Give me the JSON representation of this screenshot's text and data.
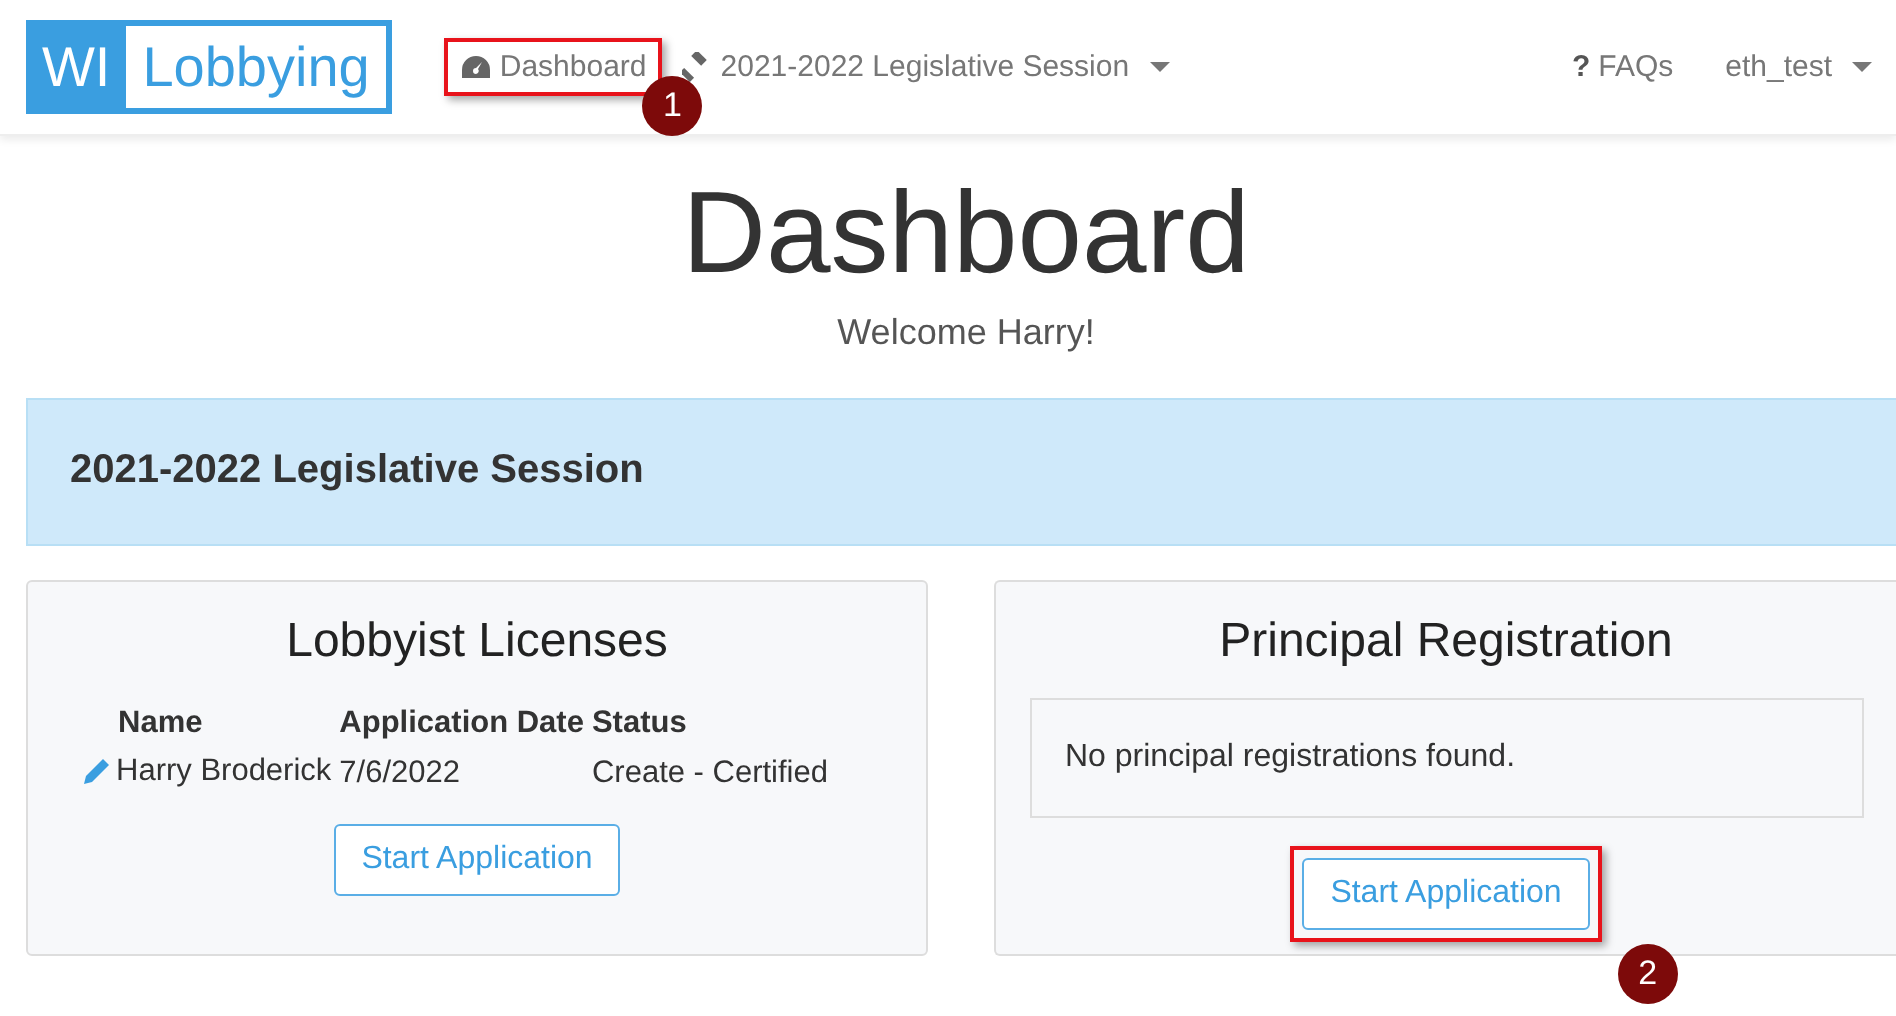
{
  "logo": {
    "prefix": "WI",
    "name": "Lobbying"
  },
  "nav": {
    "items": [
      {
        "kind": "link",
        "label": "Dashboard",
        "callout": "1"
      },
      {
        "kind": "dropdown",
        "label": "2021-2022 Legislative Session"
      }
    ],
    "right": [
      {
        "kind": "link",
        "mark": "?",
        "label": "FAQs"
      },
      {
        "kind": "dropdown",
        "label": "eth_test"
      }
    ]
  },
  "page": {
    "title": "Dashboard",
    "welcome": "Welcome Harry!"
  },
  "session": {
    "title": "2021-2022 Legislative Session"
  },
  "cards": [
    {
      "kind": "table",
      "title": "Lobbyist Licenses",
      "columns": [
        "Name",
        "Application Date",
        "Status"
      ],
      "rows": [
        {
          "editable": true,
          "cells": [
            "Harry Broderick",
            "7/6/2022",
            "Create - Certified"
          ]
        }
      ],
      "button": {
        "label": "Start Application"
      }
    },
    {
      "kind": "empty",
      "title": "Principal Registration",
      "message": "No principal registrations found.",
      "button": {
        "label": "Start Application",
        "callout": "2"
      }
    }
  ]
}
